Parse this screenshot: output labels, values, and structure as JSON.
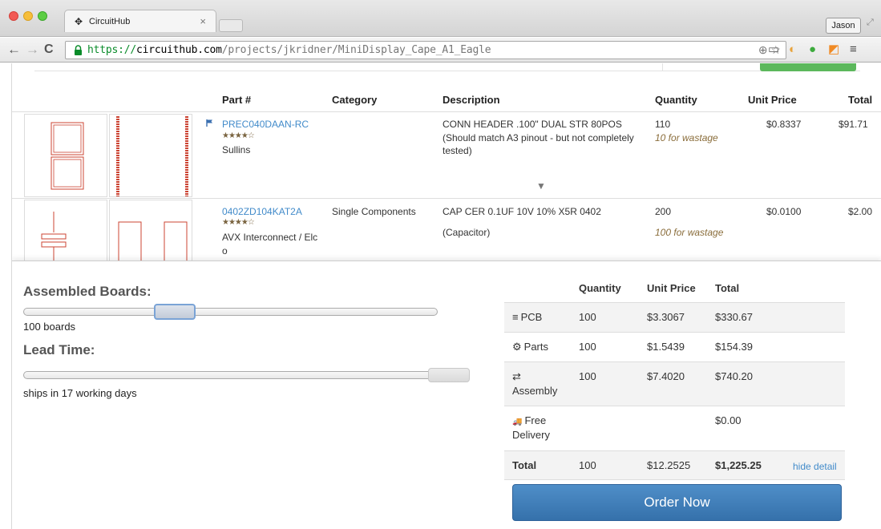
{
  "browser": {
    "tab_title": "CircuitHub",
    "tab_close": "×",
    "user_label": "Jason",
    "url_protocol": "https://",
    "url_host": "circuithub.com",
    "url_path": "/projects/jkridner/MiniDisplay_Cape_A1_Eagle",
    "nav_back": "←",
    "nav_forward": "→",
    "nav_reload": "C"
  },
  "bom": {
    "headers": {
      "part": "Part #",
      "category": "Category",
      "description": "Description",
      "quantity": "Quantity",
      "unit_price": "Unit Price",
      "total": "Total"
    },
    "rows": [
      {
        "part": "PREC040DAAN-RC",
        "stars": "★★★★☆",
        "manufacturer": "Sullins",
        "category": "",
        "description": "CONN HEADER .100\" DUAL STR 80POS",
        "description_note": "(Should match A3 pinout - but not completely tested)",
        "quantity": "110",
        "quantity_note": "10 for wastage",
        "unit_price": "$0.8337",
        "total": "$91.71",
        "expand": "▼"
      },
      {
        "part": "0402ZD104KAT2A",
        "stars": "★★★★☆",
        "manufacturer": "AVX Interconnect / Elc",
        "manufacturer_cont": "o",
        "category": "Single Components",
        "description": "CAP CER 0.1UF 10V 10% X5R 0402",
        "description_note": "(Capacitor)",
        "quantity": "200",
        "quantity_note": "100 for wastage",
        "unit_price": "$0.0100",
        "total": "$2.00"
      }
    ]
  },
  "config": {
    "boards_label": "Assembled Boards:",
    "boards_value": "100 boards",
    "boards_slider_fraction": 0.35,
    "lead_label": "Lead Time:",
    "lead_value": "ships in 17 working days",
    "lead_slider_fraction": 1.0
  },
  "quote": {
    "headers": {
      "quantity": "Quantity",
      "unit_price": "Unit Price",
      "total": "Total"
    },
    "rows": [
      {
        "icon": "≡",
        "item": "PCB",
        "quantity": "100",
        "unit_price": "$3.3067",
        "total": "$330.67"
      },
      {
        "icon": "⚙",
        "item": "Parts",
        "quantity": "100",
        "unit_price": "$1.5439",
        "total": "$154.39"
      },
      {
        "icon": "⇄",
        "item": "Assembly",
        "quantity": "100",
        "unit_price": "$7.4020",
        "total": "$740.20"
      },
      {
        "icon": "🚚",
        "item": "Free",
        "item_line2": "Delivery",
        "quantity": "",
        "unit_price": "",
        "total": "$0.00"
      }
    ],
    "total_row": {
      "label": "Total",
      "quantity": "100",
      "unit_price": "$12.2525",
      "total": "$1,225.25",
      "hide_detail": "hide detail"
    },
    "order_button": "Order Now"
  },
  "colors": {
    "link": "#428bca",
    "order_button": "#3e7fbb",
    "green_button": "#5cb85c",
    "ssl_green": "#0a8c2a"
  }
}
